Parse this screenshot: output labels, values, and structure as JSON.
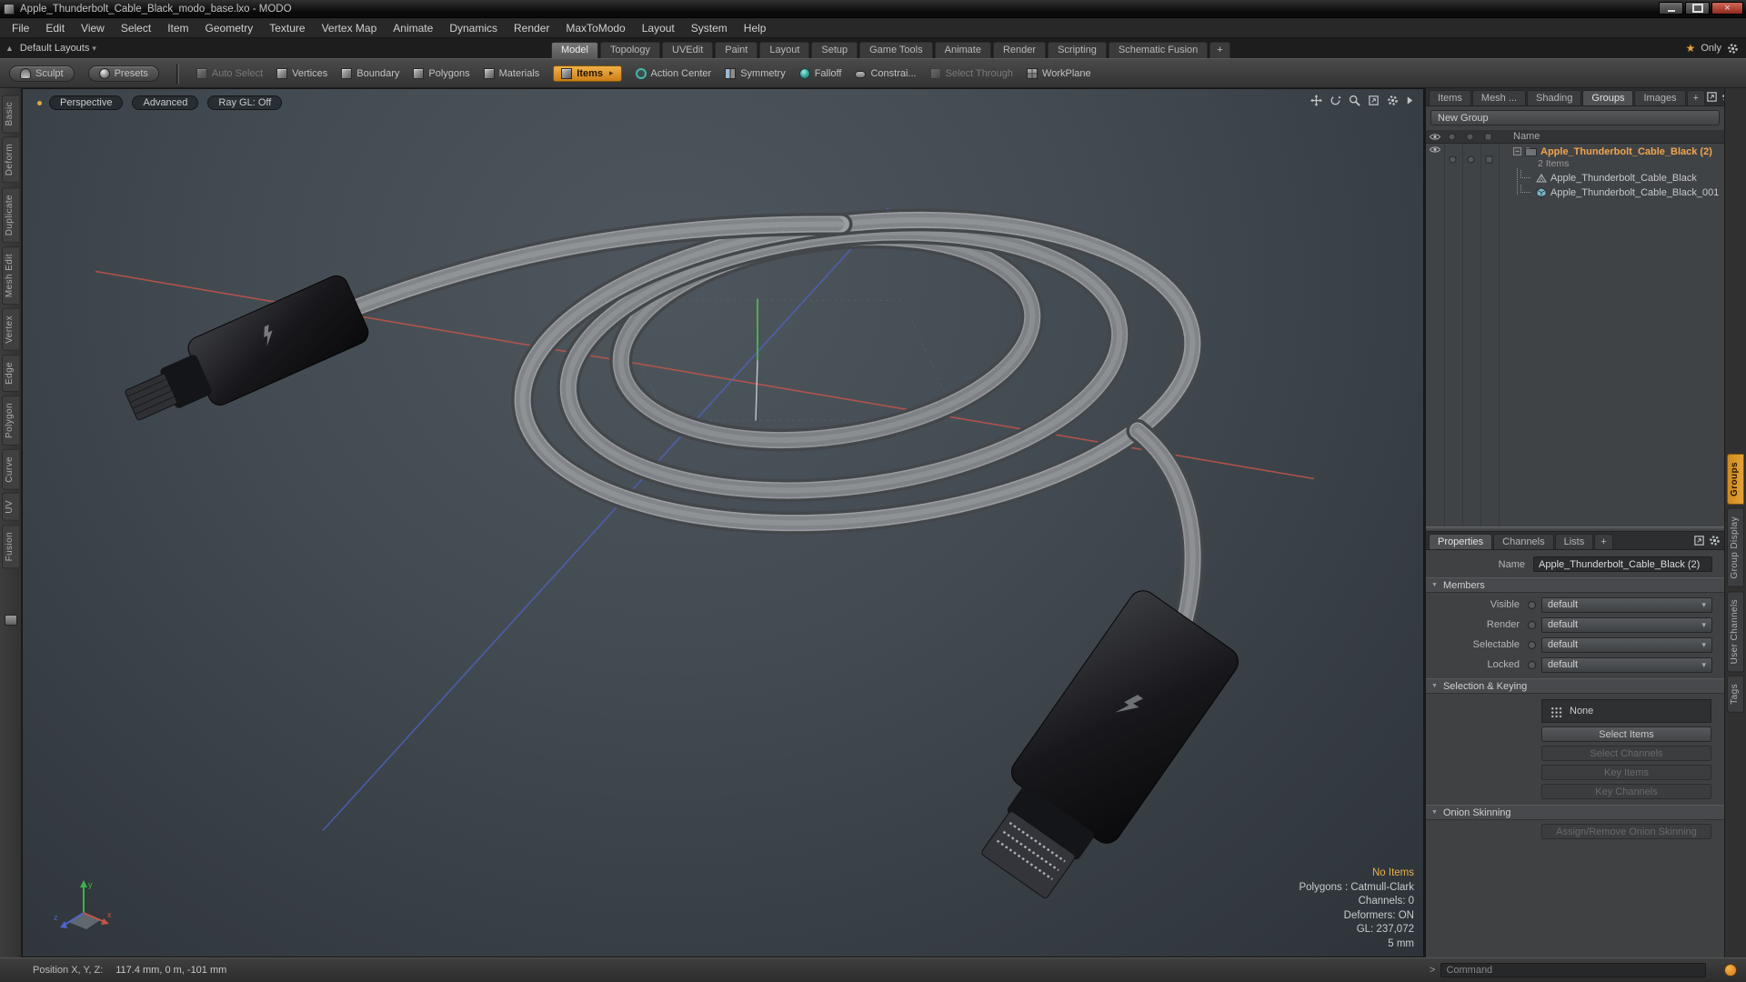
{
  "window": {
    "title": "Apple_Thunderbolt_Cable_Black_modo_base.lxo - MODO"
  },
  "menu_bar": {
    "items": [
      "File",
      "Edit",
      "View",
      "Select",
      "Item",
      "Geometry",
      "Texture",
      "Vertex Map",
      "Animate",
      "Dynamics",
      "Render",
      "MaxToModo",
      "Layout",
      "System",
      "Help"
    ]
  },
  "layout_bar": {
    "preset": "Default Layouts",
    "tabs": [
      "Model",
      "Topology",
      "UVEdit",
      "Paint",
      "Layout",
      "Setup",
      "Game Tools",
      "Animate",
      "Render",
      "Scripting",
      "Schematic Fusion"
    ],
    "active_tab": "Model",
    "add_tab": "+",
    "only": "Only"
  },
  "toolbar": {
    "buttons": [
      {
        "label": "Sculpt",
        "icon": "sculpt-icon"
      },
      {
        "label": "Presets",
        "icon": "presets-sphere-icon"
      },
      {
        "separator": true
      },
      {
        "label": "Auto Select",
        "icon": "auto-select-cube-icon",
        "disabled": true
      },
      {
        "label": "Vertices",
        "icon": "vertices-cube-icon"
      },
      {
        "label": "Boundary",
        "icon": "boundary-cube-icon"
      },
      {
        "label": "Polygons",
        "icon": "polygons-cube-icon"
      },
      {
        "label": "Materials",
        "icon": "materials-cube-icon"
      },
      {
        "label": "Items",
        "icon": "items-cube-icon",
        "active": true,
        "arrow": "▸"
      },
      {
        "label": "Action Center",
        "icon": "action-center-icon"
      },
      {
        "label": "Symmetry",
        "icon": "symmetry-icon"
      },
      {
        "label": "Falloff",
        "icon": "falloff-icon"
      },
      {
        "label": "Constrai...",
        "icon": "constraint-icon"
      },
      {
        "label": "Select Through",
        "icon": "select-through-icon",
        "disabled": true
      },
      {
        "label": "WorkPlane",
        "icon": "workplane-icon"
      }
    ]
  },
  "left_toolbox": {
    "tabs": [
      "Basic",
      "Deform",
      "Duplicate",
      "Mesh Edit",
      "Vertex",
      "Edge",
      "Polygon",
      "Curve",
      "UV",
      "Fusion"
    ]
  },
  "viewport": {
    "view_buttons": [
      "Perspective",
      "Advanced",
      "Ray GL: Off"
    ],
    "nav_icons": [
      "pan-icon",
      "orbit-icon",
      "zoom-icon",
      "maximize-icon",
      "gear-icon",
      "expand-arrow-icon"
    ],
    "stats": {
      "no_items": "No Items",
      "polygons": "Polygons : Catmull-Clark",
      "channels": "Channels: 0",
      "deformers": "Deformers: ON",
      "gl": "GL: 237,072",
      "units": "5 mm"
    },
    "axis_gizmo": {
      "x": "x",
      "y": "y",
      "z": "z"
    }
  },
  "groups_panel": {
    "tabs": [
      "Items",
      "Mesh ...",
      "Shading",
      "Groups",
      "Images"
    ],
    "active_tab": "Groups",
    "add_tab": "+",
    "new_group_label": "New Group",
    "header": "Name",
    "header_icons": [
      "eye-icon",
      "render-toggle-icon",
      "animate-toggle-icon",
      "lock-toggle-icon"
    ],
    "rows": [
      {
        "label": "Apple_Thunderbolt_Cable_Black (2)",
        "type": "group",
        "selected": true,
        "sub": "2 Items"
      },
      {
        "label": "Apple_Thunderbolt_Cable_Black",
        "type": "mesh",
        "indent": 1
      },
      {
        "label": "Apple_Thunderbolt_Cable_Black_001",
        "type": "mesh-instance",
        "indent": 1
      }
    ]
  },
  "properties_panel": {
    "tabs": [
      "Properties",
      "Channels",
      "Lists"
    ],
    "active_tab": "Properties",
    "add_tab": "+",
    "name_label": "Name",
    "name_value": "Apple_Thunderbolt_Cable_Black (2)",
    "sections": {
      "members": {
        "title": "Members",
        "rows": [
          {
            "label": "Visible",
            "value": "default"
          },
          {
            "label": "Render",
            "value": "default"
          },
          {
            "label": "Selectable",
            "value": "default"
          },
          {
            "label": "Locked",
            "value": "default"
          }
        ]
      },
      "selection_keying": {
        "title": "Selection & Keying",
        "mode_field": {
          "label": "None",
          "icon": "grid-dots-icon"
        },
        "buttons": [
          {
            "label": "Select Items"
          },
          {
            "label": "Select Channels",
            "disabled": true
          },
          {
            "label": "Key Items",
            "disabled": true
          },
          {
            "label": "Key Channels",
            "disabled": true
          }
        ]
      },
      "onion_skinning": {
        "title": "Onion Skinning",
        "buttons": [
          {
            "label": "Assign/Remove Onion Skinning",
            "disabled": true
          }
        ]
      }
    }
  },
  "side_tabs": {
    "tabs": [
      "Groups",
      "Group Display",
      "User Channels",
      "Tags"
    ],
    "active_tab": "Groups"
  },
  "status_bar": {
    "position_label": "Position X, Y, Z:",
    "position_value": "117.4 mm, 0 m, -101 mm",
    "command_prompt": ">",
    "command_placeholder": "Command"
  },
  "colors": {
    "accent_orange": "#e29a38",
    "selected_text": "#f2a54e",
    "warning_text": "#e8b14a",
    "axis_x": "#c2554a",
    "axis_y": "#4cae52",
    "axis_z": "#5064c8"
  }
}
